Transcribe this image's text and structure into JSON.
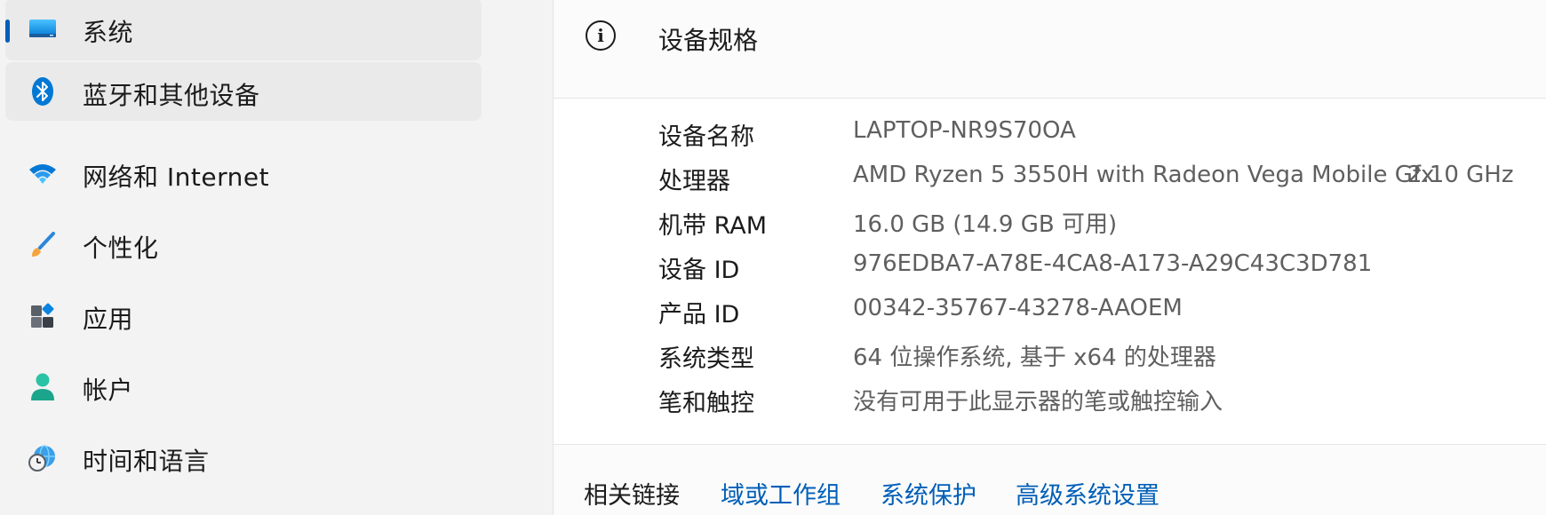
{
  "sidebar": {
    "items": [
      {
        "label": "系统",
        "icon": "monitor-icon"
      },
      {
        "label": "蓝牙和其他设备",
        "icon": "bluetooth-icon"
      },
      {
        "label": "网络和 Internet",
        "icon": "wifi-icon"
      },
      {
        "label": "个性化",
        "icon": "paintbrush-icon"
      },
      {
        "label": "应用",
        "icon": "apps-icon"
      },
      {
        "label": "帐户",
        "icon": "person-icon"
      },
      {
        "label": "时间和语言",
        "icon": "globe-clock-icon"
      }
    ],
    "selected_index": 0
  },
  "specs": {
    "title": "设备规格",
    "rows": [
      {
        "key": "设备名称",
        "value": "LAPTOP-NR9S70OA"
      },
      {
        "key": "处理器",
        "value": "AMD Ryzen 5 3550H with Radeon Vega Mobile Gfx",
        "extra": "2.10 GHz"
      },
      {
        "key": "机带 RAM",
        "value": "16.0 GB (14.9 GB 可用)"
      },
      {
        "key": "设备 ID",
        "value": "976EDBA7-A78E-4CA8-A173-A29C43C3D781"
      },
      {
        "key": "产品 ID",
        "value": "00342-35767-43278-AAOEM"
      },
      {
        "key": "系统类型",
        "value": "64 位操作系统, 基于 x64 的处理器"
      },
      {
        "key": "笔和触控",
        "value": "没有可用于此显示器的笔或触控输入"
      }
    ]
  },
  "related": {
    "label": "相关链接",
    "links": [
      "域或工作组",
      "系统保护",
      "高级系统设置"
    ]
  },
  "colors": {
    "accent": "#005fb8",
    "secondary_text": "#5f5f5f"
  }
}
